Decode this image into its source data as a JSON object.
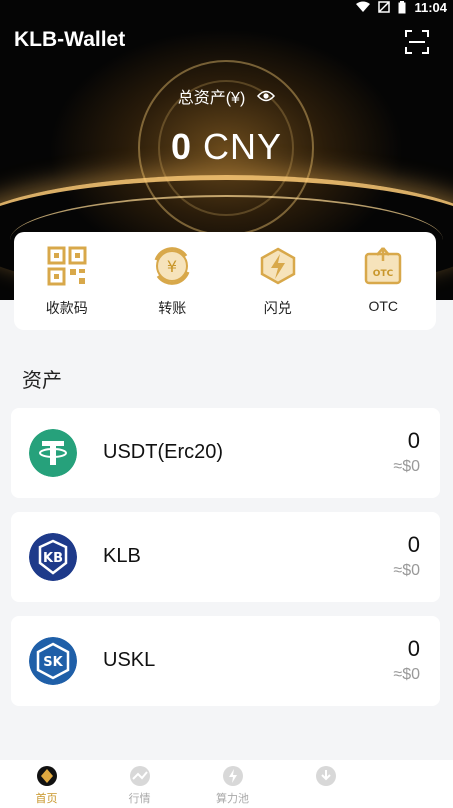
{
  "status_bar": {
    "time": "11:04"
  },
  "header": {
    "title": "KLB-Wallet"
  },
  "total": {
    "label": "总资产(¥)",
    "amount": "0",
    "currency": "CNY"
  },
  "quick_actions": [
    {
      "label": "收款码",
      "icon": "qr-code-icon"
    },
    {
      "label": "转账",
      "icon": "transfer-icon"
    },
    {
      "label": "闪兑",
      "icon": "flash-exchange-icon"
    },
    {
      "label": "OTC",
      "icon": "otc-icon",
      "badge": "OTC"
    }
  ],
  "assets_section": {
    "title": "资产"
  },
  "assets": [
    {
      "name": "USDT(Erc20)",
      "amount": "0",
      "fiat": "≈$0",
      "color": "#26a17b",
      "icon": "tether-logo",
      "mark": "T"
    },
    {
      "name": "KLB",
      "amount": "0",
      "fiat": "≈$0",
      "color": "#1e3a8a",
      "icon": "klb-logo",
      "mark": "KB"
    },
    {
      "name": "USKL",
      "amount": "0",
      "fiat": "≈$0",
      "color": "#1f5fa8",
      "icon": "uskl-logo",
      "mark": "SK"
    }
  ],
  "tabs": [
    {
      "label": "首页",
      "active": true
    },
    {
      "label": "行情",
      "active": false
    },
    {
      "label": "算力池",
      "active": false
    },
    {
      "label": "",
      "active": false
    }
  ],
  "colors": {
    "accent": "#c8962a",
    "hero_bg": "#050505"
  }
}
